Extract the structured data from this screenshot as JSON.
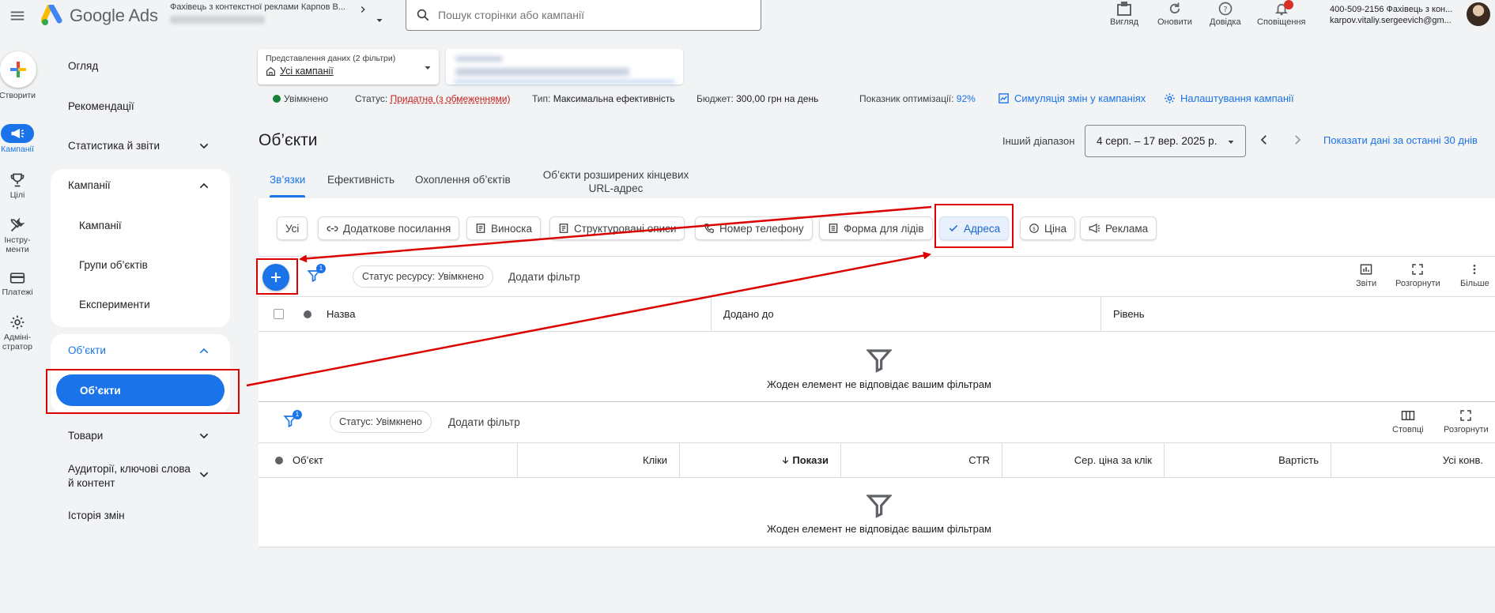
{
  "app": {
    "logo_text": "Google Ads",
    "account_name": "Фахівець з контекстної реклами Карпов В...",
    "search_placeholder": "Пошук сторінки або кампанії"
  },
  "top_actions": [
    {
      "label": "Вигляд",
      "icon": "view-icon"
    },
    {
      "label": "Оновити",
      "icon": "refresh-icon"
    },
    {
      "label": "Довідка",
      "icon": "help-icon"
    },
    {
      "label": "Сповіщення",
      "icon": "bell-icon"
    }
  ],
  "user": {
    "line1": "400-509-2156 Фахівець з кон...",
    "line2": "karpov.vitaliy.sergeevich@gm..."
  },
  "rail": {
    "create": "Створити",
    "campaigns": "Кампанії",
    "goals": "Цілі",
    "tools": "Інстру-\nменти",
    "billing": "Платежі",
    "admin": "Адміні-\nстратор"
  },
  "nav": {
    "overview": "Огляд",
    "recommendations": "Рекомендації",
    "stats": "Статистика й звіти",
    "campaigns_group": "Кампанії",
    "campaigns": "Кампанії",
    "asset_groups": "Групи об’єктів",
    "experiments": "Експерименти",
    "assets_group": "Об’єкти",
    "assets": "Об’єкти",
    "products": "Товари",
    "audiences": "Аудиторії, ключові слова й контент",
    "change_history": "Історія змін"
  },
  "view": {
    "label": "Представлення даних (2 фільтри)",
    "value": "Усі кампанії"
  },
  "status": {
    "enabled": "Увімкнено",
    "status_label": "Статус:",
    "status_value": "Придатна (з обмеженнями)",
    "type_label": "Тип:",
    "type_value": "Максимальна ефективність",
    "budget_label": "Бюджет:",
    "budget_value": "300,00 грн на день",
    "opt_label": "Показник оптимізації:",
    "opt_value": "92%",
    "simulate": "Симуляція змін у кампаніях",
    "settings": "Налаштування кампанії"
  },
  "header": {
    "title": "Об’єкти",
    "range_label": "Інший діапазон",
    "date_range": "4 серп. – 17 вер. 2025 р.",
    "last30": "Показати дані за останні 30 днів"
  },
  "tabs": [
    "Зв’язки",
    "Ефективність",
    "Охоплення об’єктів",
    "Об’єкти розширених кінцевих",
    "URL-адрес"
  ],
  "chips": [
    "Усі",
    "Додаткове посилання",
    "Виноска",
    "Структуровані описи",
    "Номер телефону",
    "Форма для лідів",
    "Адреса",
    "Ціна",
    "Реклама"
  ],
  "table1": {
    "filter_badge": "1",
    "filter_chip": "Статус ресурсу: Увімкнено",
    "add_filter": "Додати фільтр",
    "tools": [
      "Звіти",
      "Розгорнути",
      "Більше"
    ],
    "columns": [
      "Назва",
      "Додано до",
      "Рівень"
    ],
    "empty": "Жоден елемент не відповідає вашим фільтрам"
  },
  "table2": {
    "filter_badge": "1",
    "filter_chip": "Статус: Увімкнено",
    "add_filter": "Додати фільтр",
    "tools": [
      "Стовпці",
      "Розгорнути"
    ],
    "columns": [
      "Об’єкт",
      "Кліки",
      "Покази",
      "CTR",
      "Сер. ціна за клік",
      "Вартість",
      "Усі конв."
    ],
    "empty": "Жоден елемент не відповідає вашим фільтрам"
  },
  "colors": {
    "accent": "#1a73e8",
    "annotation": "#dd0000",
    "status_ok": "#188038"
  }
}
